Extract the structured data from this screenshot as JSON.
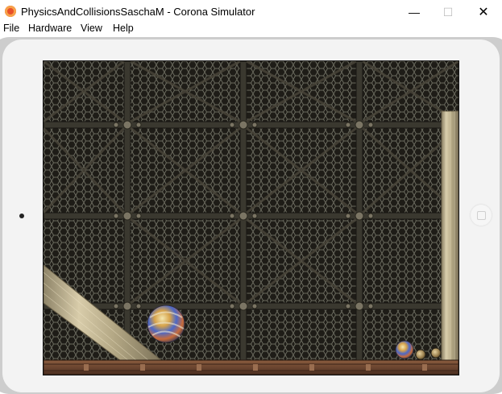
{
  "window": {
    "title": "PhysicsAndCollisionsSaschaM - Corona Simulator",
    "minimize_glyph": "—",
    "maximize_glyph": "☐",
    "close_glyph": "✕"
  },
  "menu": {
    "items": [
      {
        "label": "File"
      },
      {
        "label": "Hardware"
      },
      {
        "label": "View"
      },
      {
        "label": "Help"
      }
    ]
  },
  "colors": {
    "grate": "#1e1c17",
    "mesh": "#6a6a5e",
    "frame": "#3a382f",
    "floor": "#6e4a34",
    "wood": "#cbbf9e",
    "accent_icon": "#e8502a"
  },
  "scene": {
    "objects": [
      {
        "name": "angled-ramp",
        "type": "wooden-plank"
      },
      {
        "name": "right-wall",
        "type": "wooden-plank"
      },
      {
        "name": "floor",
        "type": "metal-floor"
      },
      {
        "name": "large-marble",
        "type": "ball"
      },
      {
        "name": "small-marble",
        "type": "ball"
      },
      {
        "name": "tiny-ball-1",
        "type": "ball"
      },
      {
        "name": "tiny-ball-2",
        "type": "ball"
      }
    ]
  }
}
